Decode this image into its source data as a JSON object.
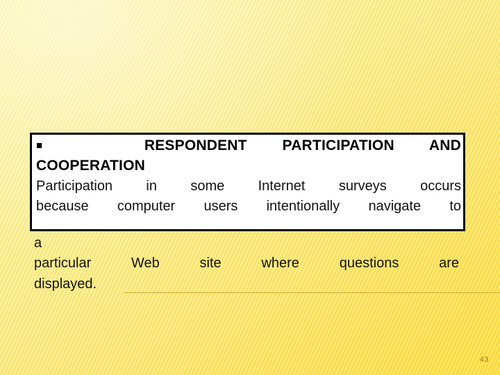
{
  "slide": {
    "background_color_top_left": "#FAF39A",
    "background_color_bottom_right": "#FBDE3E",
    "page_number": "43"
  },
  "content_box": {
    "border_color": "#000000",
    "fill_color": "#FFFFFF",
    "heading": {
      "bullet": "■",
      "line1": "RESPONDENT PARTICIPATION AND",
      "line2": "COOPERATION"
    },
    "body": {
      "line1": "Participation in some Internet surveys occurs",
      "line2": "because computer users intentionally navigate to"
    }
  },
  "overflow_body": {
    "line3": "a",
    "line4": "particular Web site where questions are",
    "line5": "displayed."
  },
  "decorations": {
    "rule_color": "#C9A227"
  }
}
